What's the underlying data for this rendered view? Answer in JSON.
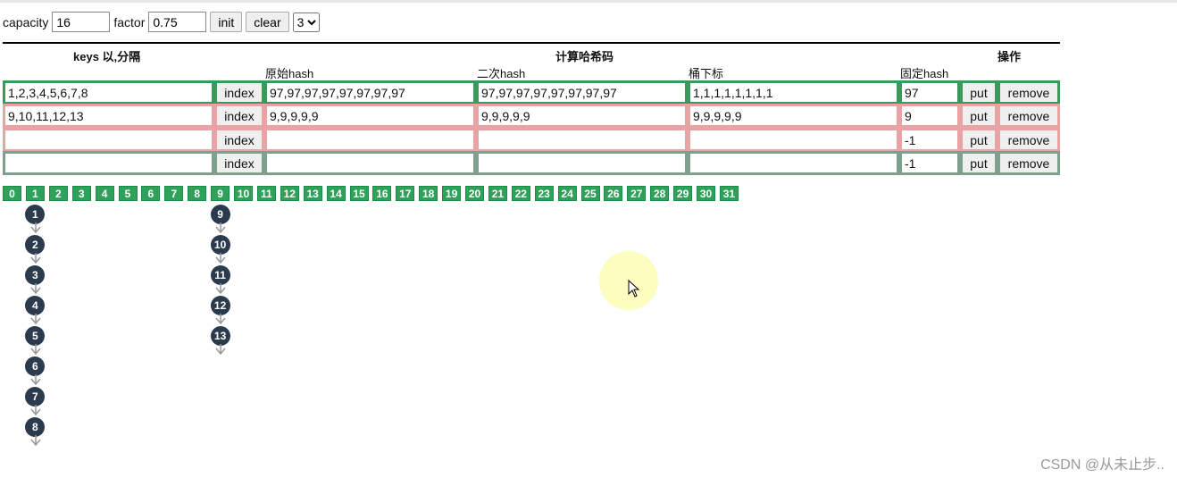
{
  "toolbar": {
    "capacity_label": "capacity",
    "capacity_value": "16",
    "factor_label": "factor",
    "factor_value": "0.75",
    "init_label": "init",
    "clear_label": "clear",
    "select_value": "3"
  },
  "headers": {
    "keys": "keys 以,分隔",
    "compute": "计算哈希码",
    "ops": "操作",
    "raw_hash": "原始hash",
    "second_hash": "二次hash",
    "bucket_index": "桶下标",
    "fixed_hash": "固定hash"
  },
  "rows": [
    {
      "keys": "1,2,3,4,5,6,7,8",
      "index": "index",
      "raw": "97,97,97,97,97,97,97,97",
      "second": "97,97,97,97,97,97,97,97",
      "bucket": "1,1,1,1,1,1,1,1",
      "fixed": "97",
      "put": "put",
      "remove": "remove",
      "color": "#3a9a5e"
    },
    {
      "keys": "9,10,11,12,13",
      "index": "index",
      "raw": "9,9,9,9,9",
      "second": "9,9,9,9,9",
      "bucket": "9,9,9,9,9",
      "fixed": "9",
      "put": "put",
      "remove": "remove",
      "color": "#e8a4a4"
    },
    {
      "keys": "",
      "index": "index",
      "raw": "",
      "second": "",
      "bucket": "",
      "fixed": "-1",
      "put": "put",
      "remove": "remove",
      "color": "#e8a4a4"
    },
    {
      "keys": "",
      "index": "index",
      "raw": "",
      "second": "",
      "bucket": "",
      "fixed": "-1",
      "put": "put",
      "remove": "remove",
      "color": "#7f9f8f"
    }
  ],
  "buckets": [
    "0",
    "1",
    "2",
    "3",
    "4",
    "5",
    "6",
    "7",
    "8",
    "9",
    "10",
    "11",
    "12",
    "13",
    "14",
    "15",
    "16",
    "17",
    "18",
    "19",
    "20",
    "21",
    "22",
    "23",
    "24",
    "25",
    "26",
    "27",
    "28",
    "29",
    "30",
    "31"
  ],
  "chains": [
    {
      "bucket": 1,
      "nodes": [
        "1",
        "2",
        "3",
        "4",
        "5",
        "6",
        "7",
        "8"
      ]
    },
    {
      "bucket": 9,
      "nodes": [
        "9",
        "10",
        "11",
        "12",
        "13"
      ]
    }
  ],
  "colors": {
    "bucket": "#2ea25a",
    "node": "#2c3a4e"
  },
  "watermark": "CSDN @从未止步.."
}
